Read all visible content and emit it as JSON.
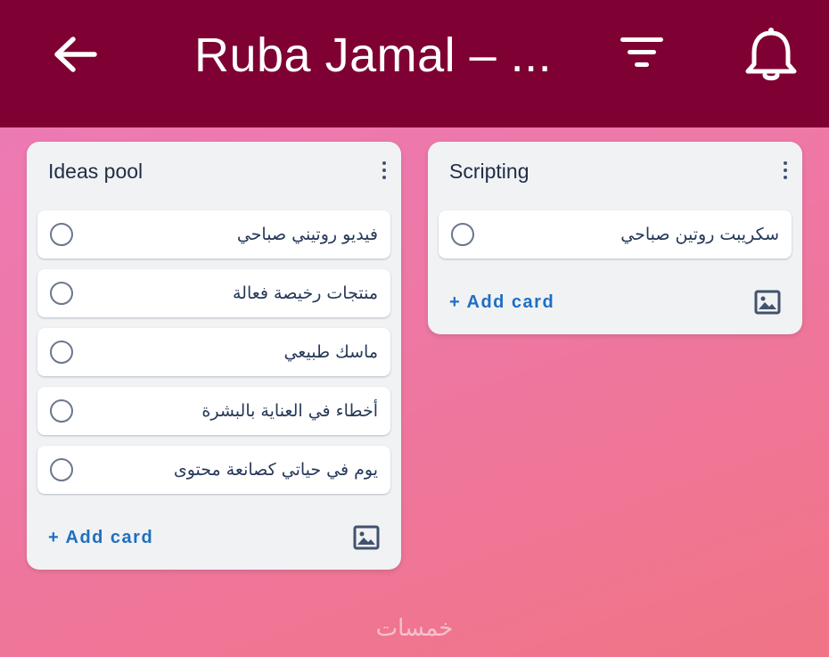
{
  "appbar": {
    "title": "Ruba Jamal – ...",
    "back_icon": "arrow-left-icon",
    "filter_icon": "filter-icon",
    "notifications_icon": "bell-icon",
    "background": "#7f0032"
  },
  "lists": [
    {
      "title": "Ideas pool",
      "cards": [
        "فيديو روتيني صباحي",
        "منتجات رخيصة فعالة",
        "ماسك طبيعي",
        "أخطاء في العناية بالبشرة",
        "يوم في حياتي كصانعة محتوى"
      ],
      "add_card_label": "+ Add card"
    },
    {
      "title": "Scripting",
      "cards": [
        "سكريبت روتين صباحي"
      ],
      "add_card_label": "+ Add card"
    }
  ],
  "watermark": "خمسات",
  "colors": {
    "accent": "#1e6fc2",
    "list_bg": "#f1f2f4"
  }
}
